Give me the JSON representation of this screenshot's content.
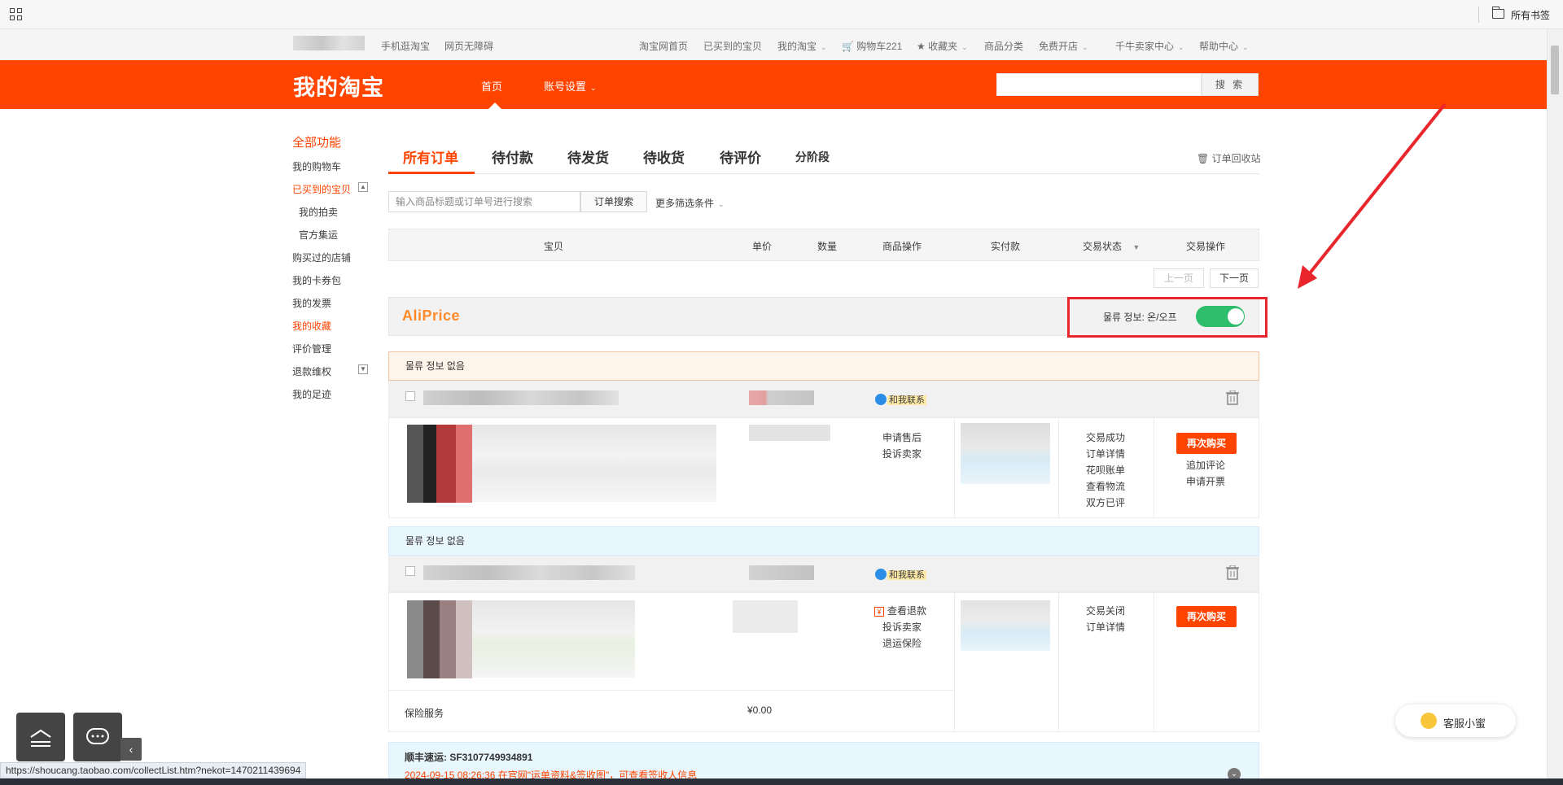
{
  "browser": {
    "all_bookmarks": "所有书签",
    "status_url": "https://shoucang.taobao.com/collectList.htm?nekot=1470211439694"
  },
  "site_nav": {
    "mobile": "手机逛淘宝",
    "accessible": "网页无障碍",
    "home": "淘宝网首页",
    "bought": "已买到的宝贝",
    "my_taobao": "我的淘宝",
    "cart": "购物车221",
    "favorites": "收藏夹",
    "categories": "商品分类",
    "open_shop": "免费开店",
    "seller_center": "千牛卖家中心",
    "help": "帮助中心"
  },
  "header": {
    "logo": "我的淘宝",
    "nav_home": "首页",
    "nav_account": "账号设置",
    "search_button": "搜 索"
  },
  "sidebar": {
    "title": "全部功能",
    "items": [
      "我的购物车",
      "已买到的宝贝",
      "我的拍卖",
      "官方集运",
      "购买过的店铺",
      "我的卡券包",
      "我的发票",
      "我的收藏",
      "评价管理",
      "退款维权",
      "我的足迹"
    ]
  },
  "tabs": {
    "all": "所有订单",
    "pending_pay": "待付款",
    "pending_ship": "待发货",
    "pending_receive": "待收货",
    "pending_review": "待评价",
    "installment": "分阶段",
    "recycle": "订单回收站"
  },
  "order_search": {
    "placeholder": "输入商品标题或订单号进行搜索",
    "button": "订单搜索",
    "more": "更多筛选条件"
  },
  "table_header": {
    "item": "宝贝",
    "price": "单价",
    "qty": "数量",
    "ops": "商品操作",
    "paid": "实付款",
    "status": "交易状态",
    "actions": "交易操作"
  },
  "pager": {
    "prev": "上一页",
    "next": "下一页"
  },
  "aliprice": {
    "title": "AliPrice",
    "toggle_label": "물류 정보: 온/오프",
    "toggle_on": true
  },
  "orders": [
    {
      "logistics": "물류 정보 없음",
      "contact": "和我联系",
      "item_ops": [
        "申请售后",
        "投诉卖家"
      ],
      "status_links": [
        "交易成功",
        "订单详情",
        "花呗账单",
        "查看物流",
        "双方已评"
      ],
      "rebuy": "再次购买",
      "extra_links": [
        "追加评论",
        "申请开票"
      ]
    },
    {
      "logistics": "물류 정보 없음",
      "contact": "和我联系",
      "refund_link": "查看退款",
      "item_ops": [
        "投诉卖家",
        "退运保险"
      ],
      "status_links": [
        "交易关闭",
        "订单详情"
      ],
      "rebuy": "再次购买",
      "insurance_label": "保险服务",
      "insurance_price": "¥0.00"
    }
  ],
  "shipment": {
    "title": "顺丰速运:   SF3107749934891",
    "detail": "2024-09-15 08:26:36 在官网\"运单资料&签收图\"，可查看签收人信息"
  },
  "service": {
    "label": "客服小蜜"
  },
  "colors": {
    "brand": "#ff4400",
    "toggle": "#2ebd6b",
    "highlight_box": "#e8262c"
  }
}
